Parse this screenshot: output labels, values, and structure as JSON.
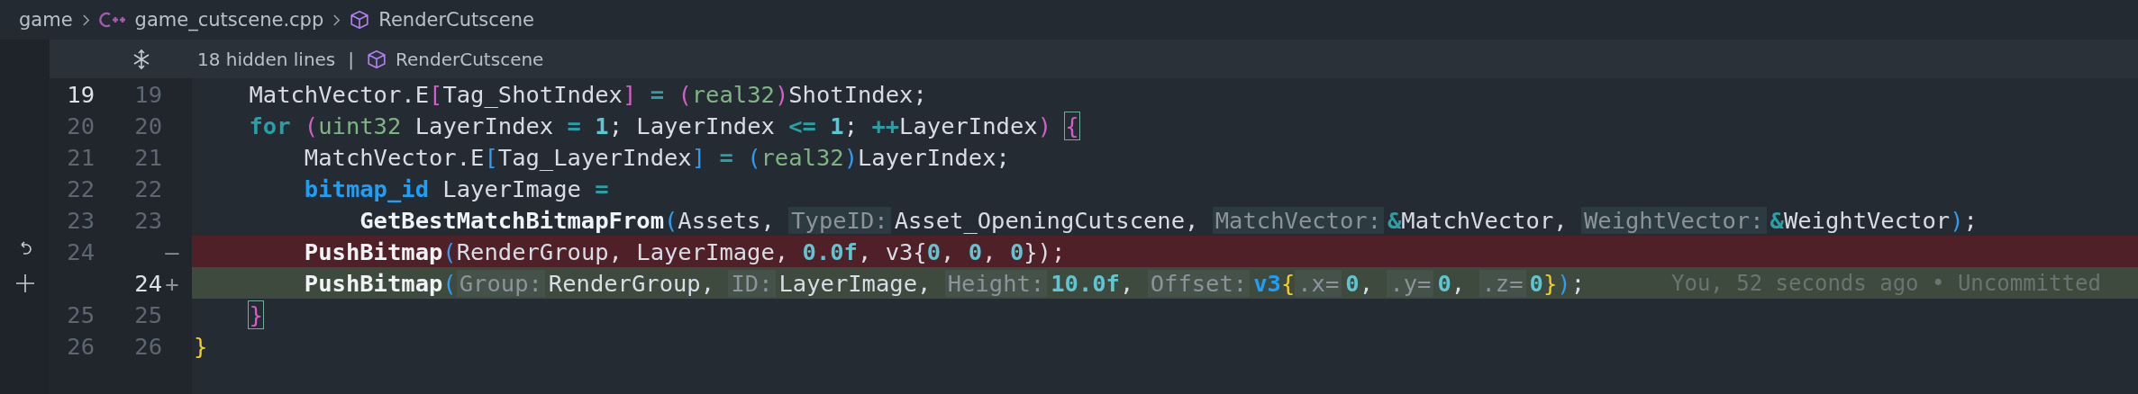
{
  "breadcrumb": [
    {
      "label": "game"
    },
    {
      "label": "game_cutscene.cpp"
    },
    {
      "label": "RenderCutscene"
    }
  ],
  "folded": {
    "text": "18 hidden lines",
    "separator": "|",
    "symbol": "RenderCutscene"
  },
  "lines": [
    {
      "old": "19",
      "new": "19",
      "kind": "context",
      "current": true,
      "tokens": [
        {
          "text": "    MatchVector.E",
          "kind": "plain"
        },
        {
          "text": "[",
          "kind": "br1"
        },
        {
          "text": "Tag_ShotIndex",
          "kind": "plain"
        },
        {
          "text": "] ",
          "kind": "br1"
        },
        {
          "text": "= ",
          "kind": "op"
        },
        {
          "text": "(",
          "kind": "br1"
        },
        {
          "text": "real32",
          "kind": "type"
        },
        {
          "text": ")",
          "kind": "br1"
        },
        {
          "text": "ShotIndex;",
          "kind": "plain"
        }
      ]
    },
    {
      "old": "20",
      "new": "20",
      "kind": "context",
      "current": false,
      "tokens": [
        {
          "text": "    for ",
          "kind": "keyword"
        },
        {
          "text": "(",
          "kind": "br1"
        },
        {
          "text": "uint32",
          "kind": "type"
        },
        {
          "text": " LayerIndex ",
          "kind": "plain"
        },
        {
          "text": "= ",
          "kind": "op"
        },
        {
          "text": "1",
          "kind": "num"
        },
        {
          "text": "; LayerIndex ",
          "kind": "plain"
        },
        {
          "text": "<= ",
          "kind": "op"
        },
        {
          "text": "1",
          "kind": "num"
        },
        {
          "text": "; ",
          "kind": "plain"
        },
        {
          "text": "++",
          "kind": "op"
        },
        {
          "text": "LayerIndex",
          "kind": "plain"
        },
        {
          "text": ") ",
          "kind": "br1"
        },
        {
          "text": "{",
          "kind": "br1-box"
        }
      ]
    },
    {
      "old": "21",
      "new": "21",
      "kind": "context",
      "current": false,
      "tokens": [
        {
          "text": "        MatchVector.E",
          "kind": "plain"
        },
        {
          "text": "[",
          "kind": "br2"
        },
        {
          "text": "Tag_LayerIndex",
          "kind": "plain"
        },
        {
          "text": "] ",
          "kind": "br2"
        },
        {
          "text": "= ",
          "kind": "op"
        },
        {
          "text": "(",
          "kind": "br2"
        },
        {
          "text": "real32",
          "kind": "type"
        },
        {
          "text": ")",
          "kind": "br2"
        },
        {
          "text": "LayerIndex;",
          "kind": "plain"
        }
      ]
    },
    {
      "old": "22",
      "new": "22",
      "kind": "context",
      "current": false,
      "tokens": [
        {
          "text": "        bitmap_id",
          "kind": "typekw"
        },
        {
          "text": " LayerImage ",
          "kind": "plain"
        },
        {
          "text": "=",
          "kind": "op"
        }
      ]
    },
    {
      "old": "23",
      "new": "23",
      "kind": "context",
      "current": false,
      "tokens": [
        {
          "text": "            GetBestMatchBitmapFrom",
          "kind": "func"
        },
        {
          "text": "(",
          "kind": "br2"
        },
        {
          "text": "Assets, ",
          "kind": "plain"
        },
        {
          "text": "TypeID:",
          "kind": "hint"
        },
        {
          "text": "Asset_OpeningCutscene, ",
          "kind": "plain"
        },
        {
          "text": "MatchVector:",
          "kind": "hint"
        },
        {
          "text": "&",
          "kind": "op"
        },
        {
          "text": "MatchVector, ",
          "kind": "plain"
        },
        {
          "text": "WeightVector:",
          "kind": "hint"
        },
        {
          "text": "&",
          "kind": "op"
        },
        {
          "text": "WeightVector",
          "kind": "plain"
        },
        {
          "text": ")",
          "kind": "br2"
        },
        {
          "text": ";",
          "kind": "plain"
        }
      ]
    },
    {
      "old": "24",
      "marker": "—",
      "kind": "removed",
      "current": false,
      "tokens": [
        {
          "text": "        PushBitmap",
          "kind": "func"
        },
        {
          "text": "(",
          "kind": "br2"
        },
        {
          "text": "RenderGroup, LayerImage, ",
          "kind": "plain"
        },
        {
          "text": "0.0f",
          "kind": "num"
        },
        {
          "text": ", v3{",
          "kind": "plain"
        },
        {
          "text": "0",
          "kind": "num"
        },
        {
          "text": ", ",
          "kind": "plain"
        },
        {
          "text": "0",
          "kind": "num"
        },
        {
          "text": ", ",
          "kind": "plain"
        },
        {
          "text": "0",
          "kind": "num"
        },
        {
          "text": "});",
          "kind": "plain"
        }
      ]
    },
    {
      "new": "24",
      "marker": "+",
      "kind": "added",
      "current": true,
      "blame": "You, 52 seconds ago • Uncommitted",
      "tokens": [
        {
          "text": "        PushBitmap",
          "kind": "func"
        },
        {
          "text": "(",
          "kind": "br2"
        },
        {
          "text": "Group:",
          "kind": "hint"
        },
        {
          "text": "RenderGroup, ",
          "kind": "plain"
        },
        {
          "text": "ID:",
          "kind": "hint"
        },
        {
          "text": "LayerImage, ",
          "kind": "plain"
        },
        {
          "text": "Height:",
          "kind": "hint"
        },
        {
          "text": "10.0f",
          "kind": "num"
        },
        {
          "text": ", ",
          "kind": "plain"
        },
        {
          "text": "Offset:",
          "kind": "hint"
        },
        {
          "text": "v3",
          "kind": "typekw"
        },
        {
          "text": "{",
          "kind": "br3"
        },
        {
          "text": ".x=",
          "kind": "hint"
        },
        {
          "text": "0",
          "kind": "num"
        },
        {
          "text": ", ",
          "kind": "plain"
        },
        {
          "text": ".y=",
          "kind": "hint"
        },
        {
          "text": "0",
          "kind": "num"
        },
        {
          "text": ", ",
          "kind": "plain"
        },
        {
          "text": ".z=",
          "kind": "hint"
        },
        {
          "text": "0",
          "kind": "num"
        },
        {
          "text": "}",
          "kind": "br3"
        },
        {
          "text": ")",
          "kind": "br2"
        },
        {
          "text": ";",
          "kind": "plain"
        }
      ]
    },
    {
      "old": "25",
      "new": "25",
      "kind": "context",
      "current": false,
      "tokens": [
        {
          "text": "    }",
          "kind": "br1-box"
        }
      ]
    },
    {
      "old": "26",
      "new": "26",
      "kind": "context",
      "current": false,
      "tokens": [
        {
          "text": "}",
          "kind": "br3"
        }
      ]
    }
  ]
}
